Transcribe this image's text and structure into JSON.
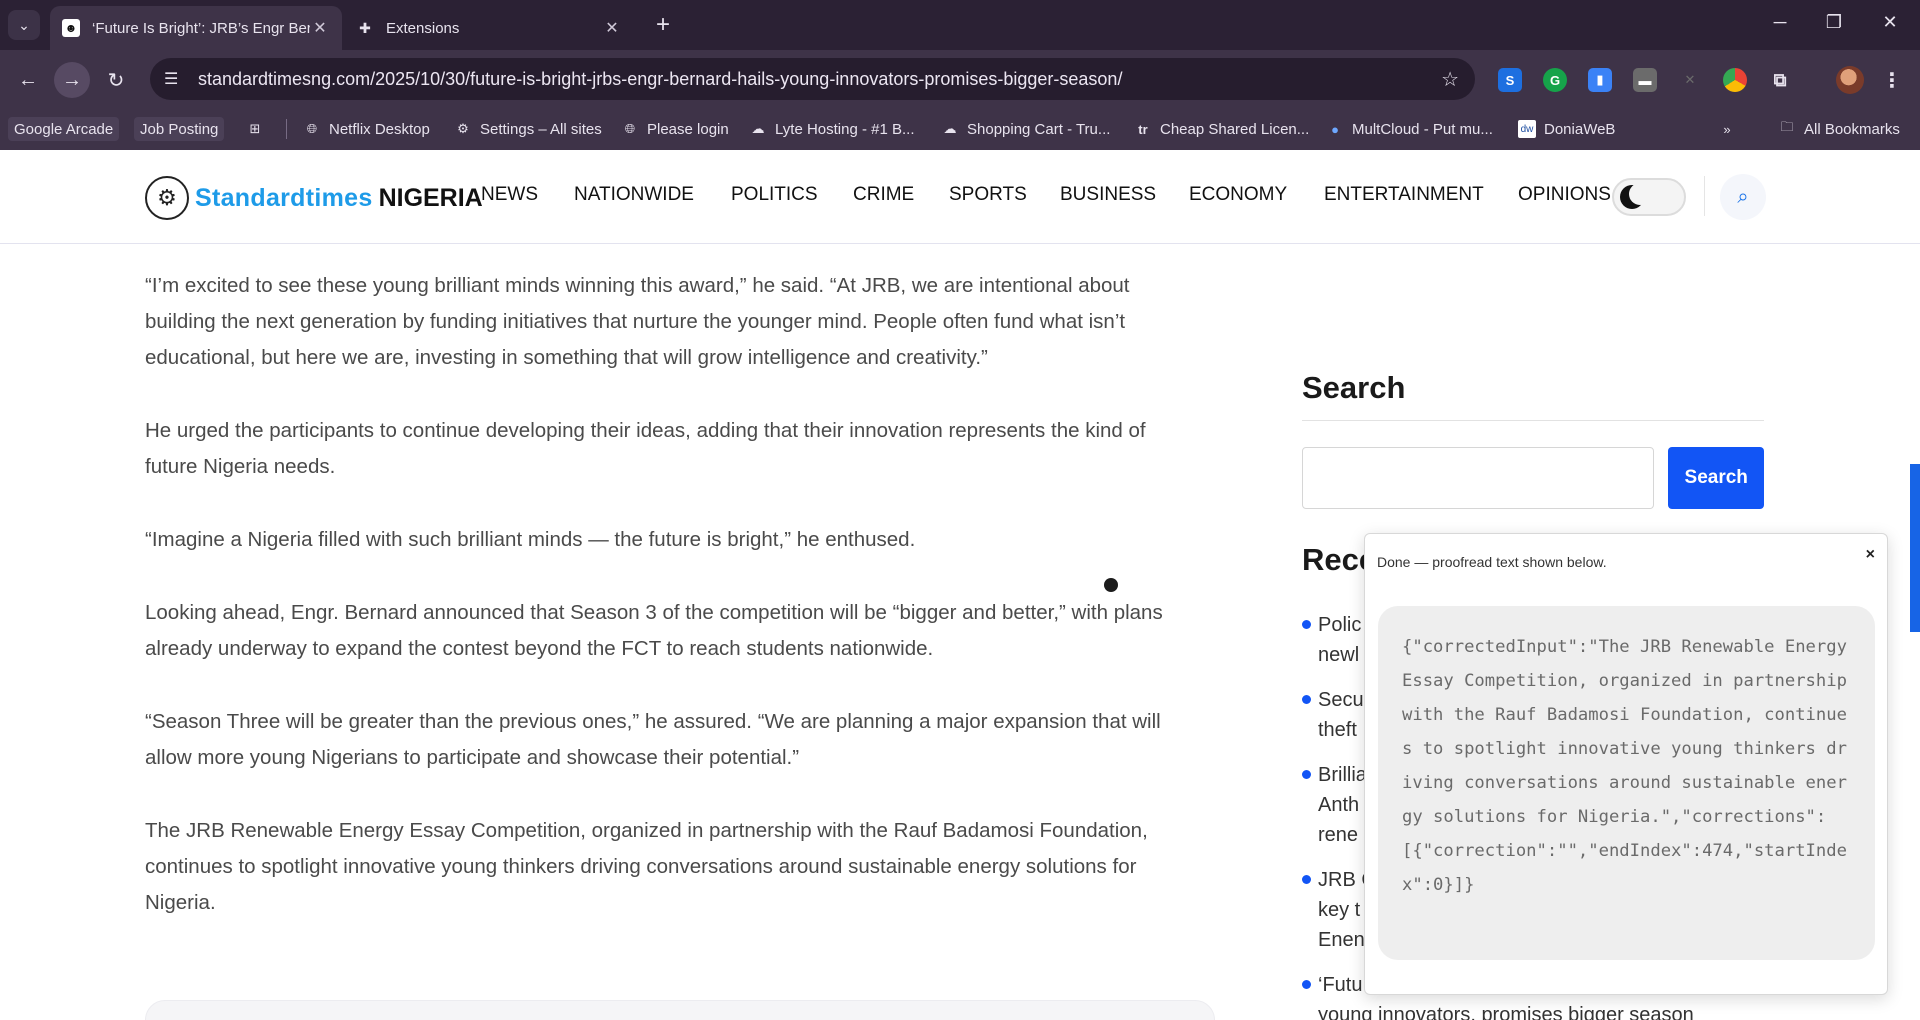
{
  "browser": {
    "tabs": [
      {
        "title": "‘Future Is Bright’: JRB’s Engr Ber",
        "active": true
      },
      {
        "title": "Extensions",
        "active": false
      }
    ],
    "new_tab_icon": "+",
    "url": "standardtimesng.com/2025/10/30/future-is-bright-jrbs-engr-bernard-hails-young-innovators-promises-bigger-season/",
    "bookmarks": [
      "Google Arcade",
      "Job Posting",
      "Netflix Desktop",
      "Settings – All sites",
      "Please login",
      "Lyte Hosting - #1 B...",
      "Shopping Cart - Tru...",
      "Cheap Shared Licen...",
      "MultCloud - Put mu...",
      "DoniaWeB",
      "All Bookmarks"
    ]
  },
  "site": {
    "logo_part1": "Standardtimes",
    "logo_part2": "NIGERIA",
    "nav": [
      "NEWS",
      "NATIONWIDE",
      "POLITICS",
      "CRIME",
      "SPORTS",
      "BUSINESS",
      "ECONOMY",
      "ENTERTAINMENT",
      "OPINIONS"
    ]
  },
  "article": {
    "paragraphs": [
      "“I’m excited to see these young brilliant minds winning this award,” he said. “At JRB, we are intentional about building the next generation by funding initiatives that nurture the younger mind. People often fund what isn’t educational, but here we are, investing in something that will grow intelligence and creativity.”",
      "He urged the participants to continue developing their ideas, adding that their innovation represents the kind of future Nigeria needs.",
      "“Imagine a Nigeria filled with such brilliant minds — the future is bright,” he enthused.",
      "Looking ahead, Engr. Bernard announced that Season 3 of the competition will be “bigger and better,” with plans already underway to expand the contest beyond the FCT to reach students nationwide.",
      "“Season Three will be greater than the previous ones,” he assured. “We are planning a major expansion that will allow more young Nigerians to participate and showcase their potential.”",
      "The JRB Renewable Energy Essay Competition, organized in partnership with the Rauf Badamosi Foundation, continues to spotlight innovative young thinkers driving conversations around sustainable energy solutions for Nigeria."
    ]
  },
  "sidebar": {
    "search_heading": "Search",
    "search_button": "Search",
    "recent_heading": "Rece",
    "recent_items": [
      [
        "Polic",
        "newl"
      ],
      [
        "Secu",
        "theft"
      ],
      [
        "Brillia",
        "Anth",
        "rene"
      ],
      [
        "JRB C",
        "key t",
        "Enen"
      ],
      [
        "‘Futu",
        "young innovators, promises bigger season"
      ]
    ]
  },
  "popup": {
    "status": "Done — proofread text shown below.",
    "close": "×",
    "result": "{\"correctedInput\":\"The JRB Renewable Energy Essay Competition, organized in partnership with the Rauf Badamosi Foundation, continues to spotlight innovative young thinkers driving conversations around sustainable energy solutions for Nigeria.\",\"corrections\":[{\"correction\":\"\",\"endIndex\":474,\"startIndex\":0}]}"
  },
  "colors": {
    "chrome_dark": "#2b2134",
    "chrome_toolbar": "#3e3348",
    "brand_blue": "#1e9be8",
    "button_blue": "#1255f5"
  }
}
